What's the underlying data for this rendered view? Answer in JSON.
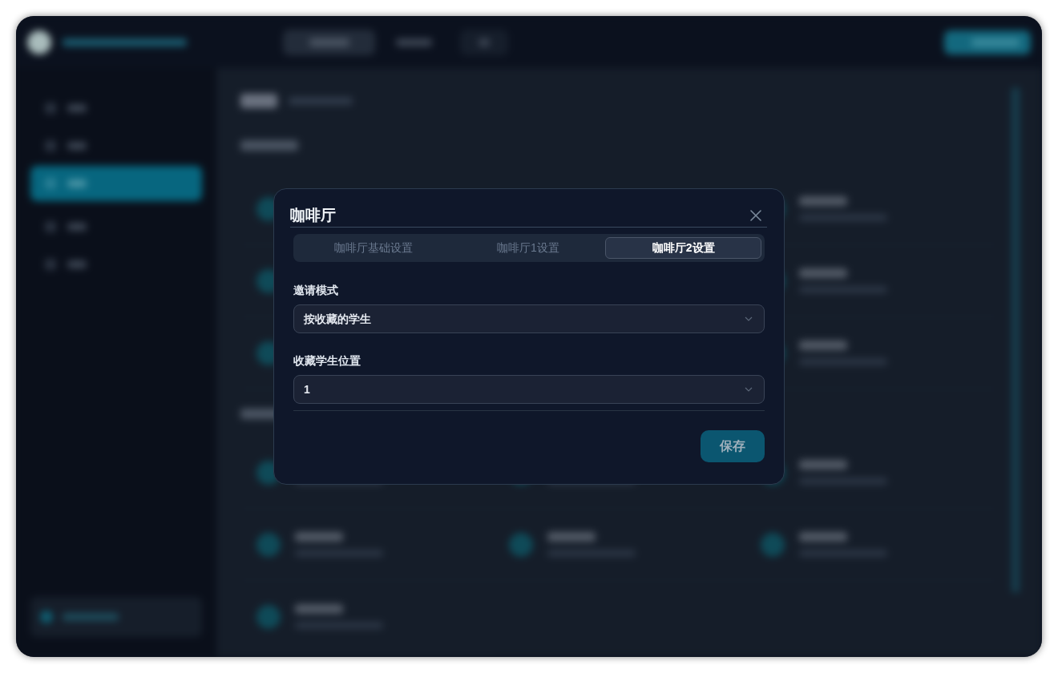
{
  "dialog": {
    "title": "咖啡厅",
    "tabs": [
      {
        "label": "咖啡厅基础设置",
        "selected": false
      },
      {
        "label": "咖啡厅1设置",
        "selected": false
      },
      {
        "label": "咖啡厅2设置",
        "selected": true
      }
    ],
    "fields": [
      {
        "label": "邀请模式",
        "value": "按收藏的学生"
      },
      {
        "label": "收藏学生位置",
        "value": "1"
      }
    ],
    "save_button": "保存"
  }
}
